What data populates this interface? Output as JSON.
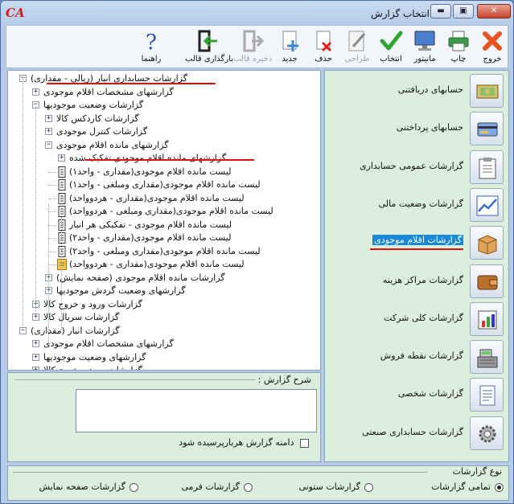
{
  "window": {
    "title": "انتخاب گزارش",
    "logo": "CA",
    "minimize": "▬",
    "restore": "▣",
    "close": "✕"
  },
  "toolbar": {
    "exit": "خروج",
    "print": "چاپ",
    "monitor": "مانیتور",
    "select": "انتخاب",
    "design": "طراحی",
    "delete": "حذف",
    "new": "جدید",
    "save_template": "ذخیره قالب",
    "load_template": "بارگذاری قالب",
    "help": "راهنما"
  },
  "tree": {
    "items": [
      {
        "label": "گزارشات حسابداری انبار (ریالی - مقداری)",
        "toggle": "−"
      },
      {
        "label": "گزارشهای مشخصات اقلام موجودی",
        "toggle": "+"
      },
      {
        "label": "گزارشات وضعیت موجودیها",
        "toggle": "−"
      },
      {
        "label": "گزارشات کاردکس کالا",
        "toggle": "+"
      },
      {
        "label": "گزارشات کنترل موجودی",
        "toggle": "+"
      },
      {
        "label": "گزارشهای مانده اقلام موجودی",
        "toggle": "−"
      },
      {
        "label": "گزارشهای مانده اقلام موجودی تفکیک شده",
        "toggle": "+"
      },
      {
        "label": "لیست مانده اقلام موجودی(مقداری - واحد۱)"
      },
      {
        "label": "لیست مانده اقلام موجودی(مقداری ومبلغی - واحد۱)"
      },
      {
        "label": "لیست مانده اقلام موجودی(مقداری - هردوواحد)"
      },
      {
        "label": "لیست مانده اقلام موجودی(مقداری ومبلغی - هردوواحد)"
      },
      {
        "label": "لیست مانده اقلام موجودی - تفکیکی هر انبار"
      },
      {
        "label": "لیست مانده اقلام موجودی(مقداری - واحد۲)"
      },
      {
        "label": "لیست مانده اقلام موجودی(مقداری ومبلغی - واحد۲)"
      },
      {
        "label": "لیست مانده اقلام موجودی(مقداری - هردوواحد)"
      },
      {
        "label": "گزارشات مانده اقلام موجودی (صفحه نمایش)",
        "toggle": "+"
      },
      {
        "label": "گزارشهای وضعیت گردش موجودیها",
        "toggle": "+"
      },
      {
        "label": "گزارشات ورود و خروج کالا",
        "toggle": "+"
      },
      {
        "label": "گزارشات سریال کالا",
        "toggle": "+"
      },
      {
        "label": "گزارشات انبار (مقداری)",
        "toggle": "−"
      },
      {
        "label": "گزارشهای مشخصات اقلام موجودی",
        "toggle": "+"
      },
      {
        "label": "گزارشهای وضعیت موجودیها",
        "toggle": "+"
      },
      {
        "label": "گزارشات ورود و خروج کالا",
        "toggle": "+"
      }
    ]
  },
  "description": {
    "legend": "شرح گزارش :",
    "textarea_value": "",
    "checkbox_label": "دامنه گزارش هربارپرسیده شود"
  },
  "categories": [
    {
      "label": "حسابهای دریافتنی",
      "icon": "receivable-icon"
    },
    {
      "label": "حسابهای پرداختنی",
      "icon": "payable-icon"
    },
    {
      "label": "گزارشات عمومی حسابداری",
      "icon": "clipboard-icon"
    },
    {
      "label": "گزارشات وضعیت مالی",
      "icon": "chart-icon"
    },
    {
      "label": "گزارشات اقلام موجودی",
      "icon": "inventory-box-icon"
    },
    {
      "label": "گزارشات مراکز هزینه",
      "icon": "wallet-icon"
    },
    {
      "label": "گزارشات کلی شرکت",
      "icon": "company-chart-icon"
    },
    {
      "label": "گزارشات نقطه فروش",
      "icon": "cash-register-icon"
    },
    {
      "label": "گزارشات شخصی",
      "icon": "document-icon"
    },
    {
      "label": "گزارشات حسابداری صنعتی",
      "icon": "gear-icon"
    }
  ],
  "report_type": {
    "legend": "نوع گزارشات",
    "options": [
      "تمامی گزارشات",
      "گزارشات ستونی",
      "گزارشات فرمی",
      "گزارشات صفحه نمایش"
    ],
    "selected": "تمامی گزارشات"
  },
  "colors": {
    "accent_red": "#e01010",
    "selected_blue": "#1a8ad8",
    "panel_green": "#dcefdc"
  }
}
